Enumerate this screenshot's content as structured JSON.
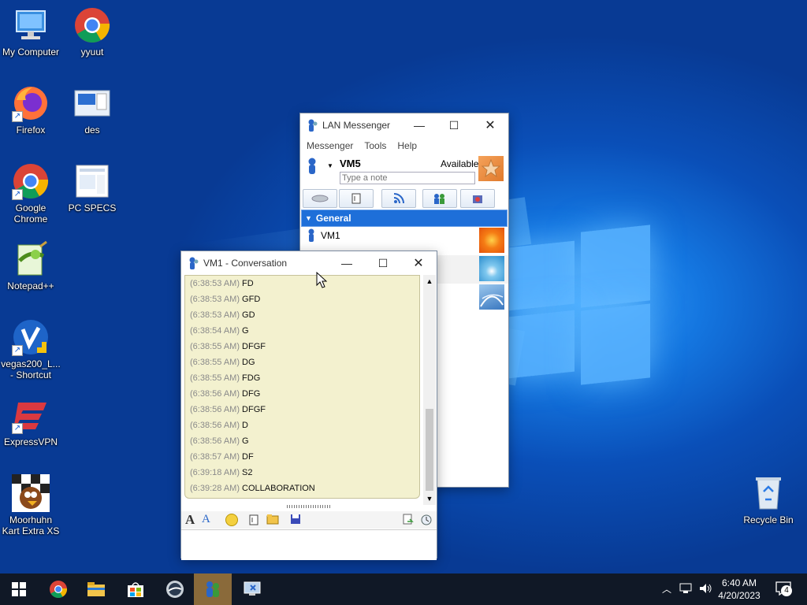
{
  "desktop": {
    "icons": [
      {
        "label": "My Computer",
        "icon": "computer-icon"
      },
      {
        "label": "yyuut",
        "icon": "chrome-icon"
      },
      {
        "label": "Firefox",
        "icon": "firefox-icon"
      },
      {
        "label": "des",
        "icon": "folder-screenshot-icon"
      },
      {
        "label": "Google Chrome",
        "icon": "chrome-icon"
      },
      {
        "label": "PC SPECS",
        "icon": "document-icon"
      },
      {
        "label": "Notepad++",
        "icon": "notepadpp-icon"
      },
      {
        "label": "vegas200_L... - Shortcut",
        "icon": "vegas-icon"
      },
      {
        "label": "ExpressVPN",
        "icon": "expressvpn-icon"
      },
      {
        "label": "Moorhuhn Kart Extra XS",
        "icon": "moorhuhn-icon"
      },
      {
        "label": "Recycle Bin",
        "icon": "recycle-bin-icon"
      }
    ]
  },
  "messenger": {
    "title": "LAN Messenger",
    "menu": [
      "Messenger",
      "Tools",
      "Help"
    ],
    "user_name": "VM5",
    "status": "Available",
    "note_placeholder": "Type a note",
    "toolbar_icons": [
      "broadcast-icon",
      "file-transfer-icon",
      "rss-icon",
      "add-contact-icon",
      "settings-icon"
    ],
    "group_name": "General",
    "contacts": [
      {
        "name": "VM1",
        "avatar": "flower-avatar"
      }
    ],
    "extra_avatars": [
      "palm-avatar",
      "ferris-avatar"
    ]
  },
  "conversation": {
    "title": "VM1 - Conversation",
    "messages": [
      {
        "time": "(6:38:53 AM)",
        "text": "FD"
      },
      {
        "time": "(6:38:53 AM)",
        "text": "GFD"
      },
      {
        "time": "(6:38:53 AM)",
        "text": "GD"
      },
      {
        "time": "(6:38:54 AM)",
        "text": "G"
      },
      {
        "time": "(6:38:55 AM)",
        "text": "DFGF"
      },
      {
        "time": "(6:38:55 AM)",
        "text": "DG"
      },
      {
        "time": "(6:38:55 AM)",
        "text": "FDG"
      },
      {
        "time": "(6:38:56 AM)",
        "text": "DFG"
      },
      {
        "time": "(6:38:56 AM)",
        "text": "DFGF"
      },
      {
        "time": "(6:38:56 AM)",
        "text": "D"
      },
      {
        "time": "(6:38:56 AM)",
        "text": "G"
      },
      {
        "time": "(6:38:57 AM)",
        "text": "DF"
      },
      {
        "time": "(6:39:18 AM)",
        "text": "S2"
      },
      {
        "time": "(6:39:28 AM)",
        "text": "COLLABORATION"
      }
    ],
    "input_value": ""
  },
  "taskbar": {
    "clock_time": "6:40 AM",
    "clock_date": "4/20/2023",
    "notification_count": "4"
  }
}
